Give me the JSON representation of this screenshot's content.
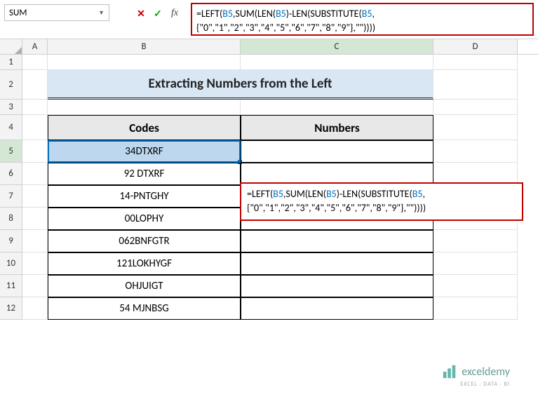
{
  "name_box": {
    "value": "SUM"
  },
  "formula_bar": {
    "formula_text": "=LEFT(B5,SUM(LEN(B5)-LEN(SUBSTITUTE(B5,{\"0\",\"1\",\"2\",\"3\",\"4\",\"5\",\"6\",\"7\",\"8\",\"9\"},\"\"))))",
    "prefix": "=LEFT(",
    "ref1": "B5",
    "mid1": ",SUM(LEN(",
    "ref2": "B5",
    "mid2": ")-LEN(SUBSTITUTE(",
    "ref3": "B5",
    "arr": ",{\"0\",\"1\",\"2\",\"3\",\"4\",\"5\",\"6\",\"7\",\"8\",\"9\"},\"\"",
    "close": "))))"
  },
  "columns": {
    "A": "A",
    "B": "B",
    "C": "C",
    "D": "D"
  },
  "row_numbers": [
    "1",
    "2",
    "3",
    "4",
    "5",
    "6",
    "7",
    "8",
    "9",
    "10",
    "11",
    "12"
  ],
  "sheet": {
    "title": "Extracting Numbers from the Left",
    "headers": {
      "codes": "Codes",
      "numbers": "Numbers"
    },
    "data": [
      {
        "code": "34DTXRF",
        "number": ""
      },
      {
        "code": "92 DTXRF",
        "number": ""
      },
      {
        "code": "14-PNTGHY",
        "number": ""
      },
      {
        "code": "00LOPHY",
        "number": ""
      },
      {
        "code": "062BNFGTR",
        "number": ""
      },
      {
        "code": "121LOKHYGF",
        "number": ""
      },
      {
        "code": "OHJUIGT",
        "number": ""
      },
      {
        "code": "54 MJNBSG",
        "number": ""
      }
    ]
  },
  "active_cell": "C5",
  "referenced_cell": "B5",
  "watermark": {
    "brand": "exceldemy",
    "tagline": "EXCEL · DATA · BI"
  },
  "chart_data": {
    "type": "table",
    "title": "Extracting Numbers from the Left",
    "columns": [
      "Codes",
      "Numbers"
    ],
    "rows": [
      [
        "34DTXRF",
        ""
      ],
      [
        "92 DTXRF",
        ""
      ],
      [
        "14-PNTGHY",
        ""
      ],
      [
        "00LOPHY",
        ""
      ],
      [
        "062BNFGTR",
        ""
      ],
      [
        "121LOKHYGF",
        ""
      ],
      [
        "OHJUIGT",
        ""
      ],
      [
        "54 MJNBSG",
        ""
      ]
    ]
  }
}
